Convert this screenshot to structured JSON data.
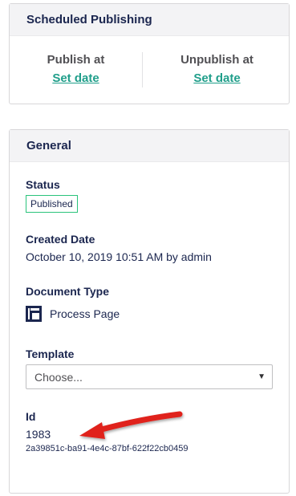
{
  "scheduled": {
    "title": "Scheduled Publishing",
    "publish_label": "Publish at",
    "publish_link": "Set date",
    "unpublish_label": "Unpublish at",
    "unpublish_link": "Set date"
  },
  "general": {
    "title": "General",
    "status_label": "Status",
    "status_value": "Published",
    "created_label": "Created Date",
    "created_value": "October 10, 2019 10:51 AM by admin",
    "doctype_label": "Document Type",
    "doctype_icon": "layout-icon",
    "doctype_value": "Process Page",
    "template_label": "Template",
    "template_value": "Choose...",
    "id_label": "Id",
    "id_number": "1983",
    "id_key": "2a39851c-ba91-4e4c-87bf-622f22cb0459"
  },
  "colors": {
    "accent": "#2bc37c",
    "annotation_arrow": "#e0211b",
    "text": "#1b264f"
  }
}
